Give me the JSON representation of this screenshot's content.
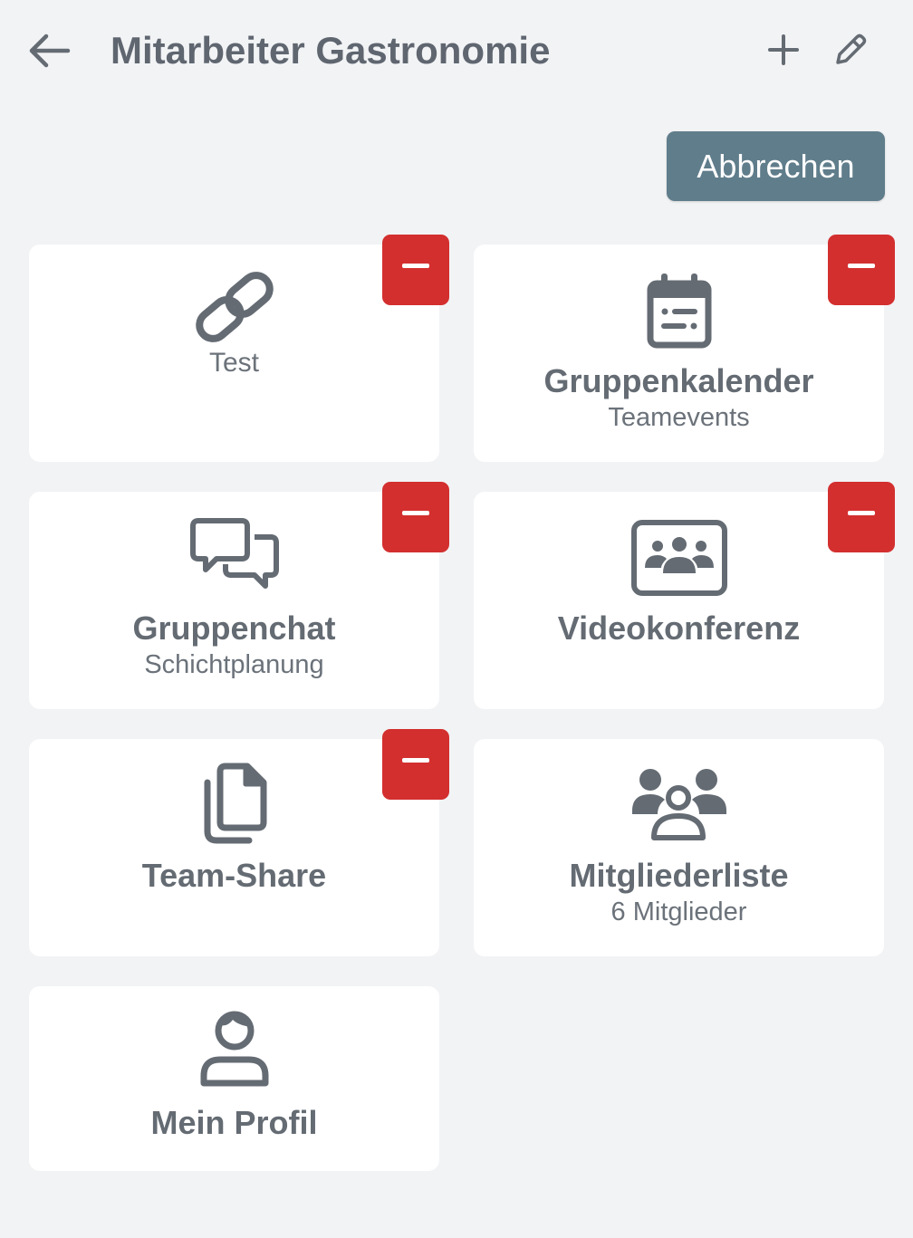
{
  "header": {
    "title": "Mitarbeiter Gastronomie",
    "back_icon": "arrow-left-icon",
    "add_icon": "plus-icon",
    "edit_icon": "pencil-icon"
  },
  "actions": {
    "cancel_label": "Abbrechen"
  },
  "tiles": [
    {
      "icon": "link-icon",
      "label": "Test",
      "removable": true
    },
    {
      "icon": "calendar-icon",
      "label": "Gruppenkalender",
      "sublabel": "Teamevents",
      "removable": true
    },
    {
      "icon": "chat-icon",
      "label": "Gruppenchat",
      "sublabel": "Schichtplanung",
      "removable": true
    },
    {
      "icon": "video-conference-icon",
      "label": "Videokonferenz",
      "removable": true
    },
    {
      "icon": "documents-icon",
      "label": "Team-Share",
      "removable": true
    },
    {
      "icon": "members-icon",
      "label": "Mitgliederliste",
      "sublabel": "6 Mitglieder",
      "removable": false
    },
    {
      "icon": "profile-icon",
      "label": "Mein Profil",
      "removable": false
    }
  ],
  "colors": {
    "background": "#f2f3f5",
    "cancel_button": "#607d8b",
    "remove_button": "#d32f2f",
    "icon": "#646b73",
    "tile": "#ffffff"
  }
}
